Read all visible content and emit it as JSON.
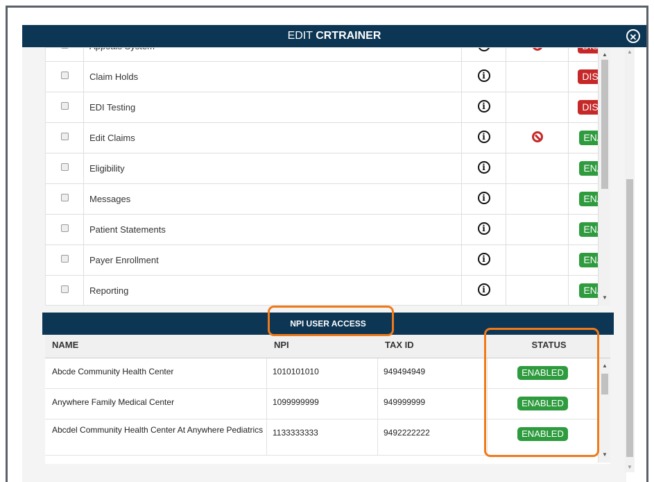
{
  "modal": {
    "title_prefix": "EDIT ",
    "title_user": "CRTRAINER",
    "close_glyph": "✕"
  },
  "services": [
    {
      "name": "Appeals System",
      "blocked": true,
      "status": "DISABLED",
      "status_color": "#c62828"
    },
    {
      "name": "Claim Holds",
      "blocked": false,
      "status": "DISABLED",
      "status_color": "#c62828"
    },
    {
      "name": "EDI Testing",
      "blocked": false,
      "status": "DISABLED",
      "status_color": "#c62828"
    },
    {
      "name": "Edit Claims",
      "blocked": true,
      "status": "ENABLED",
      "status_color": "#2e9b3e"
    },
    {
      "name": "Eligibility",
      "blocked": false,
      "status": "ENABLED",
      "status_color": "#2e9b3e"
    },
    {
      "name": "Messages",
      "blocked": false,
      "status": "ENABLED",
      "status_color": "#2e9b3e"
    },
    {
      "name": "Patient Statements",
      "blocked": false,
      "status": "ENABLED",
      "status_color": "#2e9b3e"
    },
    {
      "name": "Payer Enrollment",
      "blocked": false,
      "status": "ENABLED",
      "status_color": "#2e9b3e"
    },
    {
      "name": "Reporting",
      "blocked": false,
      "status": "ENABLED",
      "status_color": "#2e9b3e"
    }
  ],
  "npi_section": {
    "title": "NPI USER ACCESS",
    "columns": [
      "NAME",
      "NPI",
      "TAX ID",
      "STATUS"
    ],
    "rows": [
      {
        "name": "Abcde Community Health Center",
        "npi": "1010101010",
        "tax_id": "949494949",
        "status": "ENABLED"
      },
      {
        "name": "Anywhere  Family Medical Center",
        "npi": "1099999999",
        "tax_id": "949999999",
        "status": "ENABLED"
      },
      {
        "name": "Abcdel Community Health Center At Anywhere Pediatrics",
        "npi": "1133333333",
        "tax_id": "9492222222",
        "status": "ENABLED"
      }
    ]
  },
  "icons": {
    "info": "info-circle-icon",
    "blocked": "no-entry-icon",
    "close": "close-circle-icon"
  },
  "colors": {
    "header_bg": "#0c3654",
    "enabled": "#2e9b3e",
    "disabled": "#c62828",
    "highlight": "#f07a1a"
  }
}
